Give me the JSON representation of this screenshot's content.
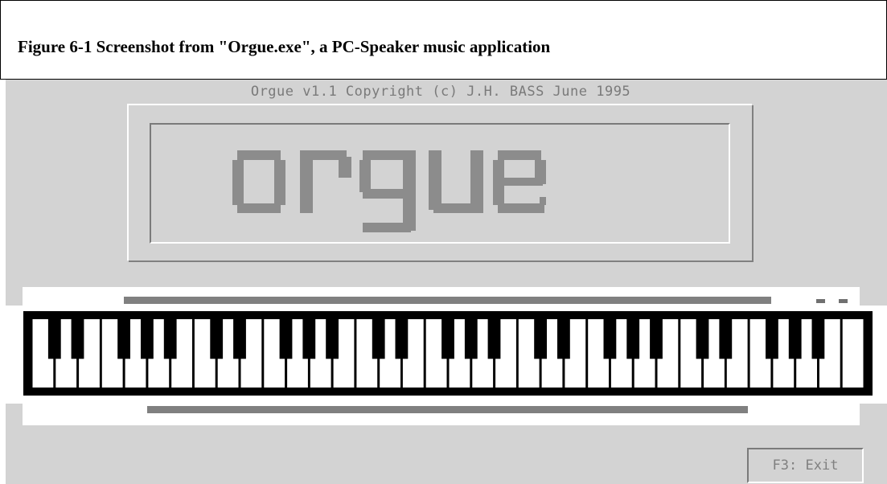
{
  "caption": {
    "text": "Figure 6-1 Screenshot from \"Orgue.exe\", a PC-Speaker music application"
  },
  "app": {
    "copyright": "Orgue v1.1 Copyright (c) J.H. BASS June 1995",
    "logo_text": "orgue",
    "exit_label": "F3: Exit"
  },
  "colors": {
    "screen_bg": "#d3d3d3",
    "logo_gray": "#8c8c8c",
    "key_white": "#ffffff",
    "key_black": "#000000",
    "bar_gray": "#808080"
  }
}
